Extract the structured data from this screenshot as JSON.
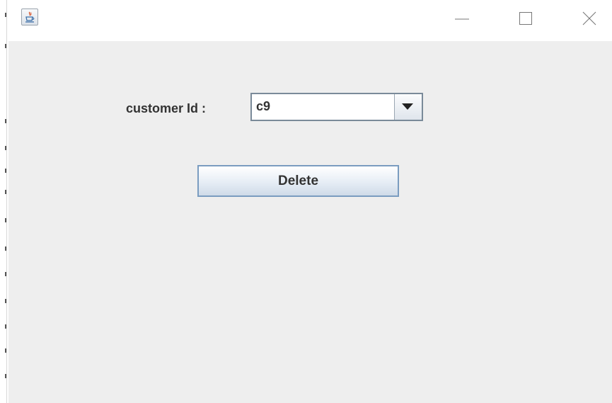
{
  "window": {
    "title": "",
    "icon": "java-coffee-cup-icon",
    "controls": {
      "minimize": "minimize-icon",
      "maximize": "maximize-icon",
      "close": "close-icon"
    }
  },
  "form": {
    "customer_id_label": "customer Id :",
    "customer_id_selected": "c9",
    "delete_label": "Delete"
  },
  "colors": {
    "content_background": "#eeeeee",
    "button_border": "#7a9cc0",
    "text": "#333333"
  }
}
